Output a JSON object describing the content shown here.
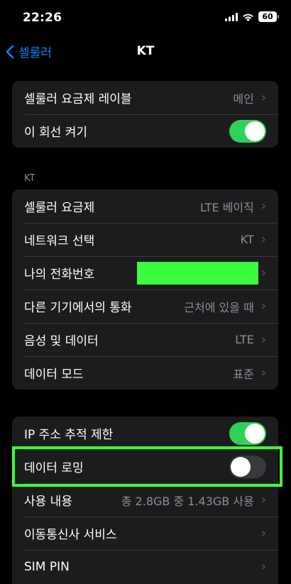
{
  "status": {
    "time": "22:26",
    "battery": "60",
    "icons": [
      "cellular-signal-icon",
      "wifi-icon",
      "battery-icon"
    ]
  },
  "nav": {
    "back_label": "셀룰러",
    "title": "KT"
  },
  "group1": {
    "rows": [
      {
        "label": "셀룰러 요금제 레이블",
        "value": "메인"
      },
      {
        "label": "이 회선 켜기",
        "toggle": "on"
      }
    ]
  },
  "section_kt": {
    "header": "KT"
  },
  "group2": {
    "rows": [
      {
        "label": "셀룰러 요금제",
        "value": "LTE 베이직"
      },
      {
        "label": "네트워크 선택",
        "value": "KT"
      },
      {
        "label": "나의 전화번호",
        "value": ""
      },
      {
        "label": "다른 기기에서의 통화",
        "value": "근처에 있을 때"
      },
      {
        "label": "음성 및 데이터",
        "value": "LTE"
      },
      {
        "label": "데이터 모드",
        "value": "표준"
      }
    ]
  },
  "group3": {
    "rows": [
      {
        "label": "IP 주소 추적 제한",
        "toggle": "on"
      },
      {
        "label": "데이터 로밍",
        "toggle": "off"
      },
      {
        "label": "사용 내용",
        "value": "총 2.8GB 중 1.43GB 사용"
      },
      {
        "label": "이동통신사 서비스",
        "value": ""
      },
      {
        "label": "SIM PIN",
        "value": ""
      }
    ]
  },
  "colors": {
    "accent": "#0a84ff",
    "toggle_on": "#30d158",
    "annotation": "#3dfc3d"
  }
}
